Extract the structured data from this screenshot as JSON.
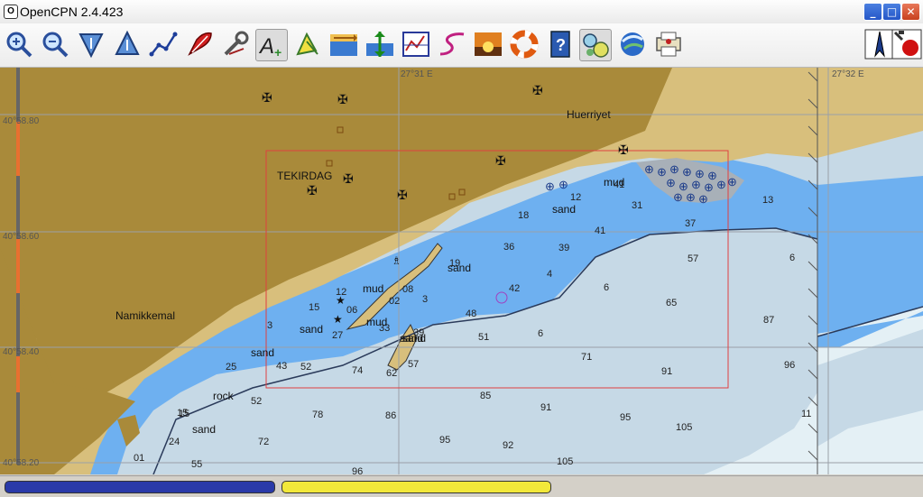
{
  "window": {
    "title": "OpenCPN 2.4.423",
    "app_icon_glyph": "O",
    "minimize": "_",
    "maximize": "□",
    "close": "✕"
  },
  "toolbar": {
    "tools": [
      {
        "name": "zoom-in-icon"
      },
      {
        "name": "zoom-out-icon"
      },
      {
        "name": "scale-down-icon"
      },
      {
        "name": "scale-up-icon"
      },
      {
        "name": "route-icon"
      },
      {
        "name": "ship-icon"
      },
      {
        "name": "settings-wrench-icon"
      },
      {
        "name": "text-toggle-icon"
      },
      {
        "name": "ais-toggle-icon"
      },
      {
        "name": "current-icon"
      },
      {
        "name": "tide-icon"
      },
      {
        "name": "chart-bar-icon"
      },
      {
        "name": "track-icon"
      },
      {
        "name": "sunset-icon"
      },
      {
        "name": "lifebuoy-icon"
      },
      {
        "name": "help-icon"
      },
      {
        "name": "chart-quilt-icon"
      },
      {
        "name": "google-earth-icon"
      },
      {
        "name": "print-icon"
      }
    ],
    "right_tools": [
      {
        "name": "compass-icon"
      },
      {
        "name": "gps-status-icon"
      }
    ]
  },
  "chart": {
    "lon_labels": [
      "27°31 E",
      "27°32 E"
    ],
    "lat_labels": [
      "40°58.80",
      "40°58.60",
      "40°58.40",
      "40°58.20"
    ],
    "place_names": [
      "TEKIRDAG",
      "Huerriyet",
      "Namikkemal"
    ],
    "seabed_labels": [
      "sand",
      "mud",
      "sand",
      "mud",
      "sand",
      "sand",
      "sand",
      "rock",
      "sand",
      "mud",
      "sand"
    ],
    "soundings": [
      "12",
      "18",
      "31",
      "37",
      "13",
      "41",
      "36",
      "39",
      "19",
      "57",
      "6",
      "4",
      "42",
      "6",
      "65",
      "3",
      "48",
      "87",
      "6",
      "51",
      "71",
      "91",
      "96",
      "85",
      "91",
      "95",
      "105",
      "11",
      "62",
      "57",
      "74",
      "52",
      "52",
      "78",
      "86",
      "72",
      "95",
      "92",
      "55",
      "96",
      "105",
      "15",
      "24",
      "25",
      "43",
      "27",
      "33",
      "15",
      "12",
      "06",
      "3",
      "01",
      "08",
      "02",
      "15",
      "39",
      "41"
    ],
    "colors": {
      "land": "#a98a3a",
      "shore": "#d8bf7c",
      "shallow": "#6eb0f0",
      "mid": "#c6d9e6",
      "deep": "#e4f0f5",
      "quilt_border": "#e04040"
    }
  },
  "status": {
    "left_color": "#2a3aa8",
    "right_color": "#f2e83a"
  }
}
